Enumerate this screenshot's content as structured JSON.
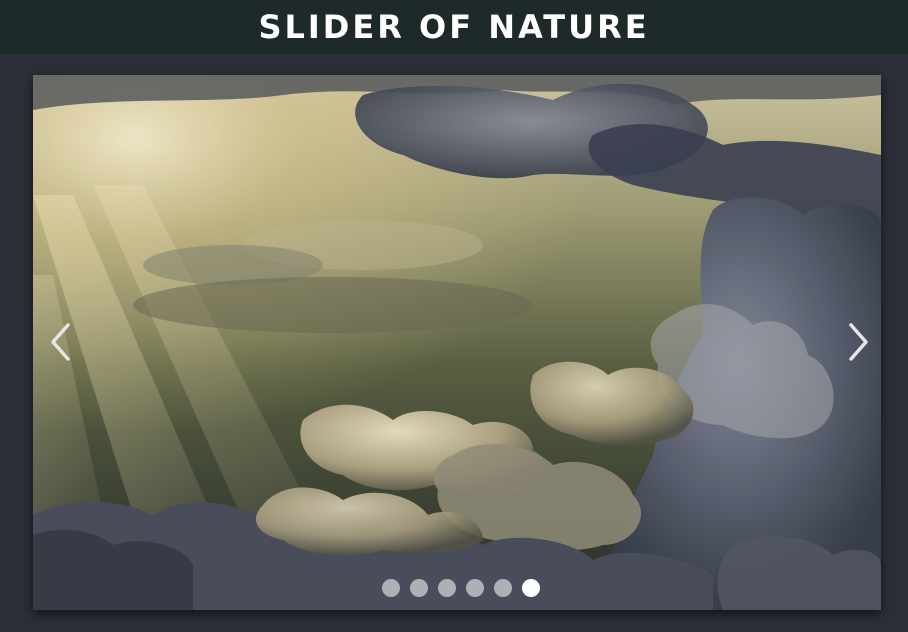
{
  "header": {
    "title": "SLIDER OF NATURE"
  },
  "slider": {
    "current_slide": 6,
    "total_slides": 6,
    "prev_icon": "chevron-left-icon",
    "next_icon": "chevron-right-icon",
    "image_subject": "clouds-sunrays",
    "colors": {
      "dot_inactive": "#d8d8d8",
      "dot_active": "#ffffff",
      "header_bg": "#1e2a2a",
      "page_bg": "#2b2f38"
    }
  }
}
